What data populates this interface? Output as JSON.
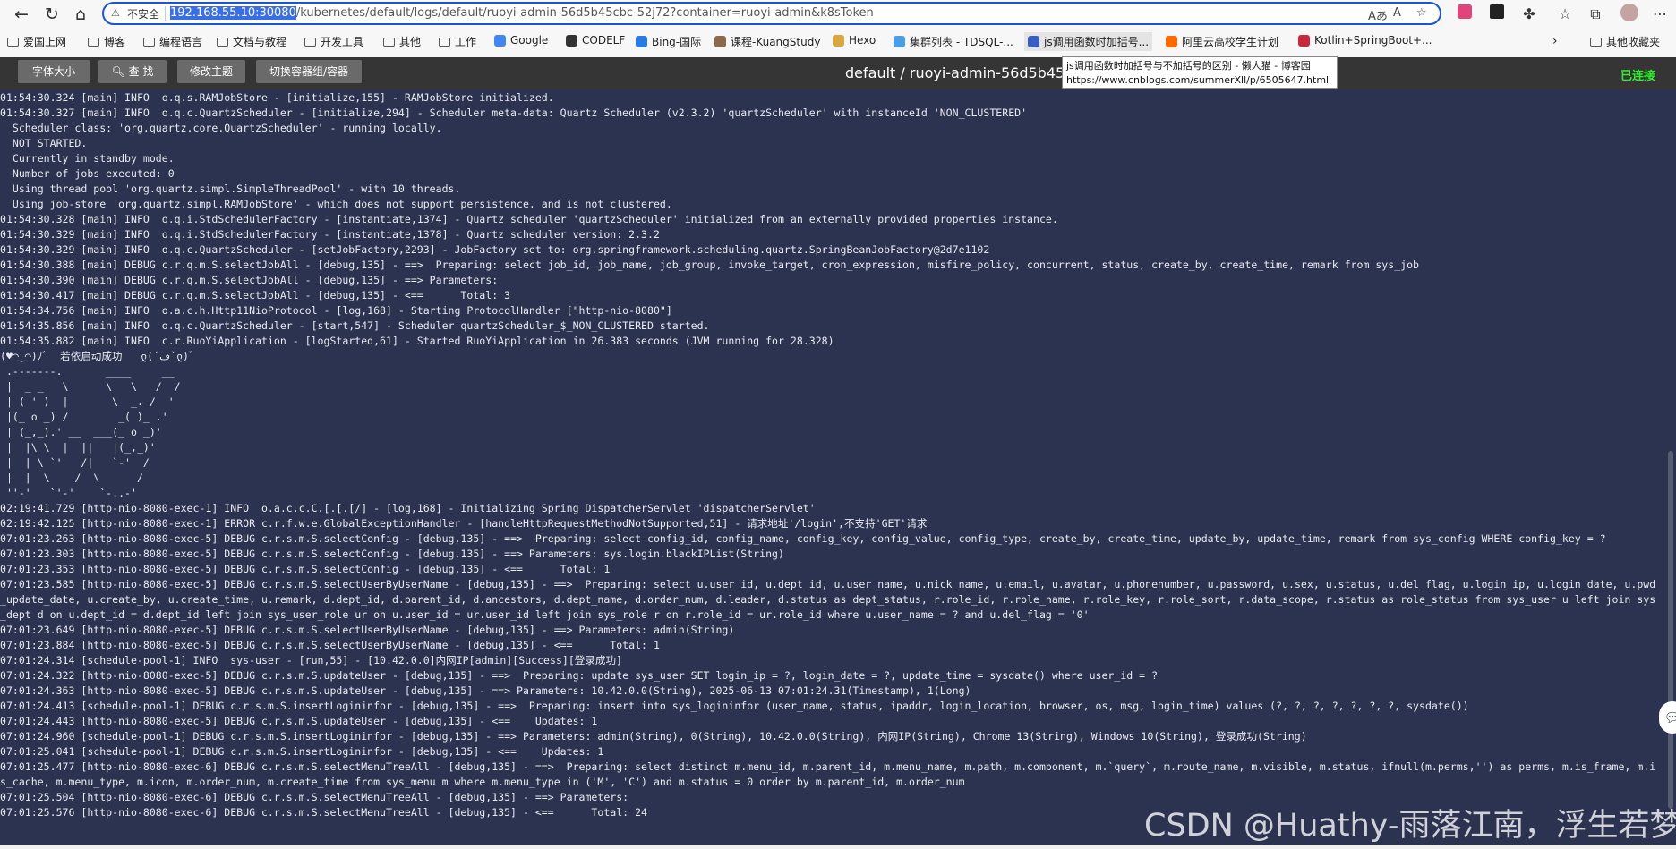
{
  "browser": {
    "security_label": "不安全",
    "url_host": "192.168.55.10:30080",
    "url_path": "/kubernetes/default/logs/default/ruoyi-admin-56d5b45cbc-52j72?container=ruoyi-admin&k8sToken",
    "read_aloud": "Aあ",
    "immersive": "A"
  },
  "bookmarks": [
    {
      "label": "爱国上网"
    },
    {
      "label": "博客"
    },
    {
      "label": "编程语言"
    },
    {
      "label": "文档与教程"
    },
    {
      "label": "开发工具"
    },
    {
      "label": "其他"
    },
    {
      "label": "工作"
    },
    {
      "label": "Google"
    },
    {
      "label": "CODELF"
    },
    {
      "label": "Bing-国际"
    },
    {
      "label": "课程-KuangStudy"
    },
    {
      "label": "Hexo"
    },
    {
      "label": "集群列表 - TDSQL-..."
    },
    {
      "label": "js调用函数时加括号..."
    },
    {
      "label": "阿里云高校学生计划"
    },
    {
      "label": "Kotlin+SpringBoot+..."
    },
    {
      "label": "其他收藏夹"
    }
  ],
  "tooltip": {
    "title": "js调用函数时加括号与不加括号的区别 - 懒人猫 - 博客园",
    "url": "https://www.cnblogs.com/summerXll/p/6505647.html"
  },
  "toolbar": {
    "font_size": "字体大小",
    "search": "查 找",
    "theme": "修改主题",
    "switch": "切换容器组/容器"
  },
  "title": "default / ruoyi-admin-56d5b45cbc",
  "status": "已连接",
  "log_lines": [
    "01:54:30.324 [main] INFO  o.q.s.RAMJobStore - [initialize,155] - RAMJobStore initialized.",
    "01:54:30.327 [main] INFO  o.q.c.QuartzScheduler - [initialize,294] - Scheduler meta-data: Quartz Scheduler (v2.3.2) 'quartzScheduler' with instanceId 'NON_CLUSTERED'",
    "  Scheduler class: 'org.quartz.core.QuartzScheduler' - running locally.",
    "  NOT STARTED.",
    "  Currently in standby mode.",
    "  Number of jobs executed: 0",
    "  Using thread pool 'org.quartz.simpl.SimpleThreadPool' - with 10 threads.",
    "  Using job-store 'org.quartz.simpl.RAMJobStore' - which does not support persistence. and is not clustered.",
    "01:54:30.328 [main] INFO  o.q.i.StdSchedulerFactory - [instantiate,1374] - Quartz scheduler 'quartzScheduler' initialized from an externally provided properties instance.",
    "01:54:30.329 [main] INFO  o.q.i.StdSchedulerFactory - [instantiate,1378] - Quartz scheduler version: 2.3.2",
    "01:54:30.329 [main] INFO  o.q.c.QuartzScheduler - [setJobFactory,2293] - JobFactory set to: org.springframework.scheduling.quartz.SpringBeanJobFactory@2d7e1102",
    "01:54:30.388 [main] DEBUG c.r.q.m.S.selectJobAll - [debug,135] - ==>  Preparing: select job_id, job_name, job_group, invoke_target, cron_expression, misfire_policy, concurrent, status, create_by, create_time, remark from sys_job",
    "01:54:30.390 [main] DEBUG c.r.q.m.S.selectJobAll - [debug,135] - ==> Parameters: ",
    "01:54:30.417 [main] DEBUG c.r.q.m.S.selectJobAll - [debug,135] - <==      Total: 3",
    "01:54:34.756 [main] INFO  o.a.c.h.Http11NioProtocol - [log,168] - Starting ProtocolHandler [\"http-nio-8080\"]",
    "01:54:35.856 [main] INFO  o.q.c.QuartzScheduler - [start,547] - Scheduler quartzScheduler_$_NON_CLUSTERED started.",
    "01:54:35.882 [main] INFO  c.r.RuoYiApplication - [logStarted,61] - Started RuoYiApplication in 26.383 seconds (JVM running for 28.328)",
    "(♥◠‿◠)ﾉﾞ  若依启动成功   ლ(´ڡ`ლ)ﾞ",
    " .-------.       ____     __",
    " |  _ _   \\      \\   \\   /  /",
    " | ( ' )  |       \\  _. /  '",
    " |(_ o _) /        _( )_ .'",
    " | (_,_).' __  ___(_ o _)'",
    " |  |\\ \\  |  ||   |(_,_)'",
    " |  | \\ `'   /|   `-'  /",
    " |  |  \\    /  \\      /",
    " ''-'   `'-'    `-..-'",
    "02:19:41.729 [http-nio-8080-exec-1] INFO  o.a.c.c.C.[.[.[/] - [log,168] - Initializing Spring DispatcherServlet 'dispatcherServlet'",
    "02:19:42.125 [http-nio-8080-exec-1] ERROR c.r.f.w.e.GlobalExceptionHandler - [handleHttpRequestMethodNotSupported,51] - 请求地址'/login',不支持'GET'请求",
    "07:01:23.263 [http-nio-8080-exec-5] DEBUG c.r.s.m.S.selectConfig - [debug,135] - ==>  Preparing: select config_id, config_name, config_key, config_value, config_type, create_by, create_time, update_by, update_time, remark from sys_config WHERE config_key = ?",
    "07:01:23.303 [http-nio-8080-exec-5] DEBUG c.r.s.m.S.selectConfig - [debug,135] - ==> Parameters: sys.login.blackIPList(String)",
    "07:01:23.353 [http-nio-8080-exec-5] DEBUG c.r.s.m.S.selectConfig - [debug,135] - <==      Total: 1",
    "07:01:23.585 [http-nio-8080-exec-5] DEBUG c.r.s.m.S.selectUserByUserName - [debug,135] - ==>  Preparing: select u.user_id, u.dept_id, u.user_name, u.nick_name, u.email, u.avatar, u.phonenumber, u.password, u.sex, u.status, u.del_flag, u.login_ip, u.login_date, u.pwd",
    "_update_date, u.create_by, u.create_time, u.remark, d.dept_id, d.parent_id, d.ancestors, d.dept_name, d.order_num, d.leader, d.status as dept_status, r.role_id, r.role_name, r.role_key, r.role_sort, r.data_scope, r.status as role_status from sys_user u left join sys",
    "_dept d on u.dept_id = d.dept_id left join sys_user_role ur on u.user_id = ur.user_id left join sys_role r on r.role_id = ur.role_id where u.user_name = ? and u.del_flag = '0'",
    "07:01:23.649 [http-nio-8080-exec-5] DEBUG c.r.s.m.S.selectUserByUserName - [debug,135] - ==> Parameters: admin(String)",
    "07:01:23.884 [http-nio-8080-exec-5] DEBUG c.r.s.m.S.selectUserByUserName - [debug,135] - <==      Total: 1",
    "07:01:24.314 [schedule-pool-1] INFO  sys-user - [run,55] - [10.42.0.0]内网IP[admin][Success][登录成功]",
    "07:01:24.322 [http-nio-8080-exec-5] DEBUG c.r.s.m.S.updateUser - [debug,135] - ==>  Preparing: update sys_user SET login_ip = ?, login_date = ?, update_time = sysdate() where user_id = ?",
    "07:01:24.363 [http-nio-8080-exec-5] DEBUG c.r.s.m.S.updateUser - [debug,135] - ==> Parameters: 10.42.0.0(String), 2025-06-13 07:01:24.31(Timestamp), 1(Long)",
    "07:01:24.413 [schedule-pool-1] DEBUG c.r.s.m.S.insertLogininfor - [debug,135] - ==>  Preparing: insert into sys_logininfor (user_name, status, ipaddr, login_location, browser, os, msg, login_time) values (?, ?, ?, ?, ?, ?, ?, sysdate())",
    "07:01:24.443 [http-nio-8080-exec-5] DEBUG c.r.s.m.S.updateUser - [debug,135] - <==    Updates: 1",
    "07:01:24.960 [schedule-pool-1] DEBUG c.r.s.m.S.insertLogininfor - [debug,135] - ==> Parameters: admin(String), 0(String), 10.42.0.0(String), 内网IP(String), Chrome 13(String), Windows 10(String), 登录成功(String)",
    "07:01:25.041 [schedule-pool-1] DEBUG c.r.s.m.S.insertLogininfor - [debug,135] - <==    Updates: 1",
    "07:01:25.477 [http-nio-8080-exec-6] DEBUG c.r.s.m.S.selectMenuTreeAll - [debug,135] - ==>  Preparing: select distinct m.menu_id, m.parent_id, m.menu_name, m.path, m.component, m.`query`, m.route_name, m.visible, m.status, ifnull(m.perms,'') as perms, m.is_frame, m.i",
    "s_cache, m.menu_type, m.icon, m.order_num, m.create_time from sys_menu m where m.menu_type in ('M', 'C') and m.status = 0 order by m.parent_id, m.order_num",
    "07:01:25.504 [http-nio-8080-exec-6] DEBUG c.r.s.m.S.selectMenuTreeAll - [debug,135] - ==> Parameters: ",
    "07:01:25.576 [http-nio-8080-exec-6] DEBUG c.r.s.m.S.selectMenuTreeAll - [debug,135] - <==      Total: 24"
  ],
  "watermark": "CSDN @Huathy-雨落江南，浮生若梦",
  "colors": {
    "accent": "#1a55d6",
    "log_bg": "#2b3350",
    "status_ok": "#2ff02f"
  }
}
